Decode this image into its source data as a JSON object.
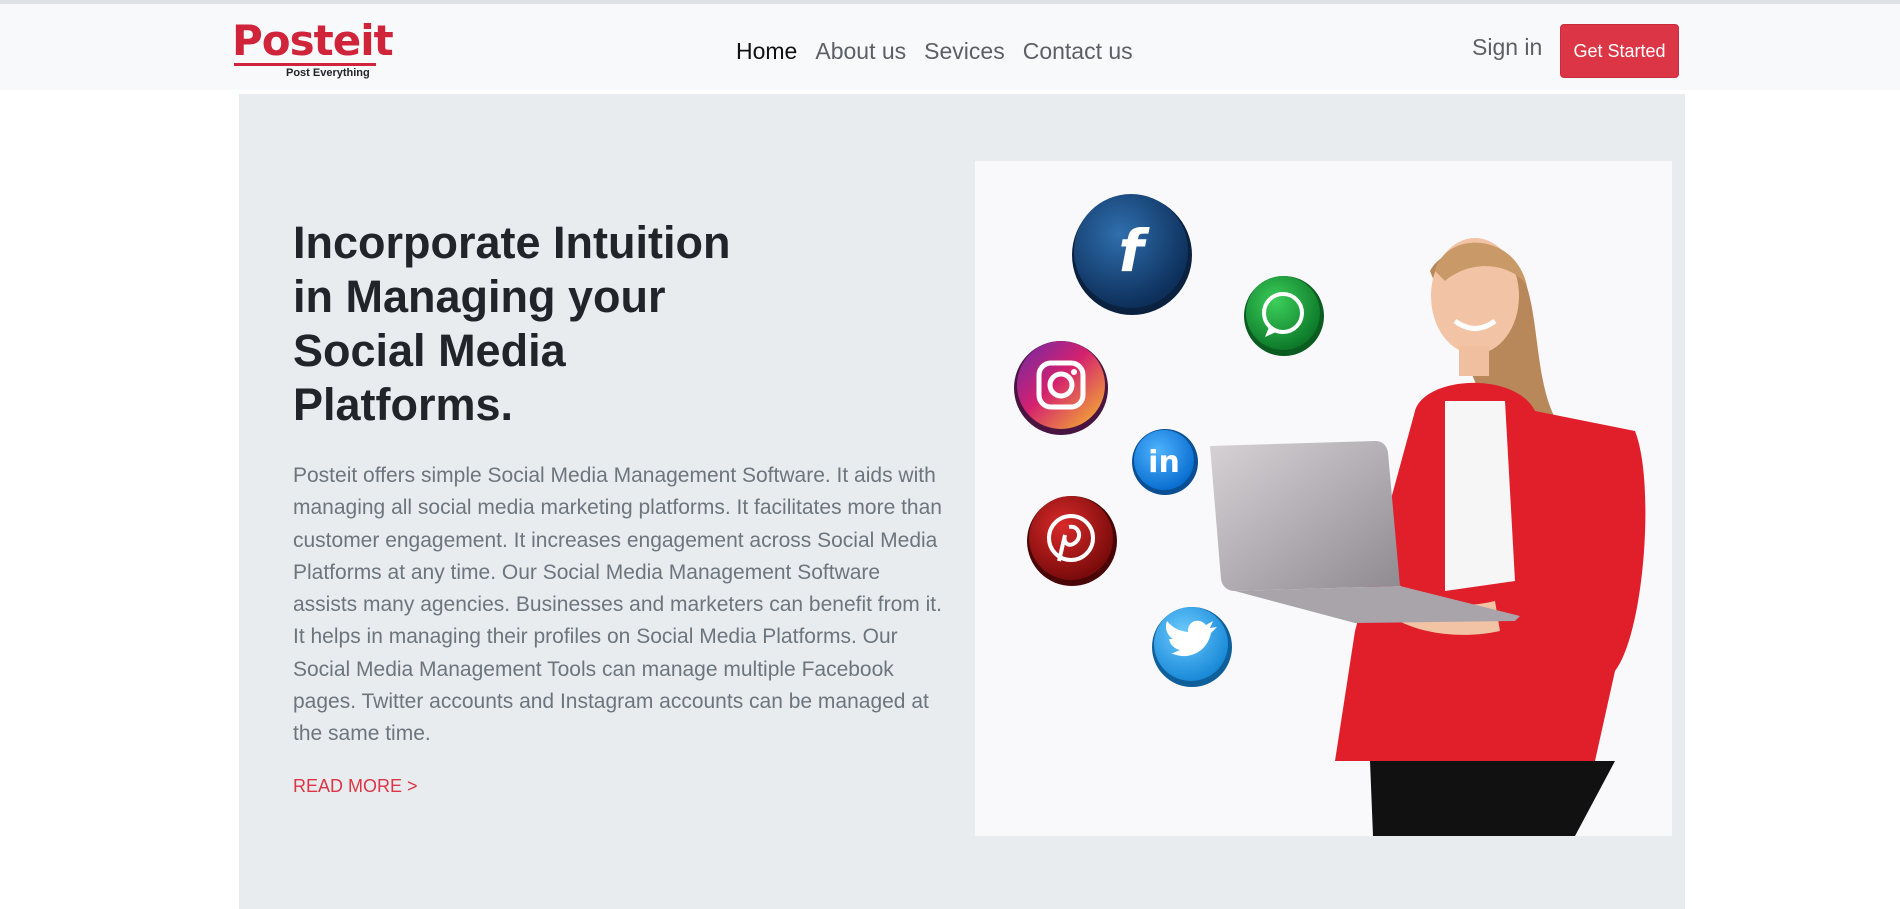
{
  "brand": {
    "name": "Posteit",
    "tagline": "Post Everything"
  },
  "nav": {
    "links": [
      {
        "label": "Home",
        "active": true
      },
      {
        "label": "About us",
        "active": false
      },
      {
        "label": "Sevices",
        "active": false
      },
      {
        "label": "Contact us",
        "active": false
      }
    ],
    "sign_in": "Sign in",
    "cta": "Get Started"
  },
  "hero": {
    "heading": "Incorporate Intuition in Managing your Social Media Platforms.",
    "body": "Posteit offers simple Social Media Management Software. It aids with managing all social media marketing platforms. It facilitates more than customer engagement. It increases engagement across Social Media Platforms at any time. Our Social Media Management Software assists many agencies. Businesses and marketers can benefit from it. It helps in managing their profiles on Social Media Platforms. Our Social Media Management Tools can manage multiple Facebook pages. Twitter accounts and Instagram accounts can be managed at the same time.",
    "read_more": "READ MORE >"
  },
  "image": {
    "icons": [
      "facebook-icon",
      "whatsapp-icon",
      "instagram-icon",
      "linkedin-icon",
      "pinterest-icon",
      "twitter-icon"
    ]
  },
  "colors": {
    "accent": "#dc3545",
    "navbar_bg": "#f8f9fa",
    "hero_bg": "#e9ecef"
  }
}
